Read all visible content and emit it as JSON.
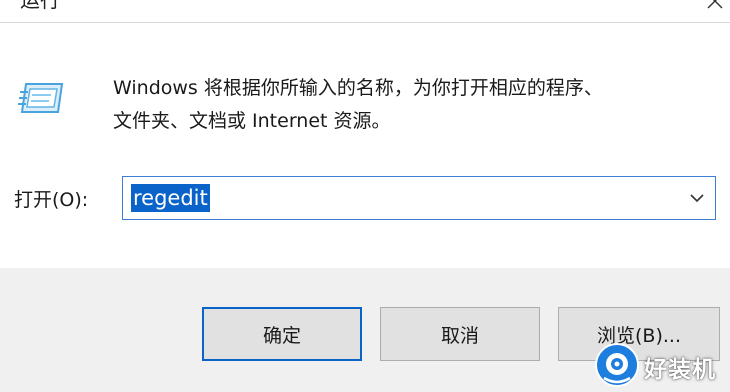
{
  "window": {
    "title": "运行"
  },
  "icons": {
    "run": "run-icon",
    "close": "close-icon",
    "dropdown": "chevron-down-icon",
    "watermark": "watermark-logo-icon"
  },
  "colors": {
    "accent": "#0a63c9",
    "footer_bg": "#f0f0f0",
    "button_bg": "#e1e1e1"
  },
  "main": {
    "description_line1": "Windows 将根据你所输入的名称，为你打开相应的程序、",
    "description_line2": "文件夹、文档或 Internet 资源。",
    "open_label": "打开(O):",
    "open_value": "regedit"
  },
  "buttons": {
    "ok": "确定",
    "cancel": "取消",
    "browse": "浏览(B)..."
  },
  "watermark": {
    "text": "好装机"
  }
}
